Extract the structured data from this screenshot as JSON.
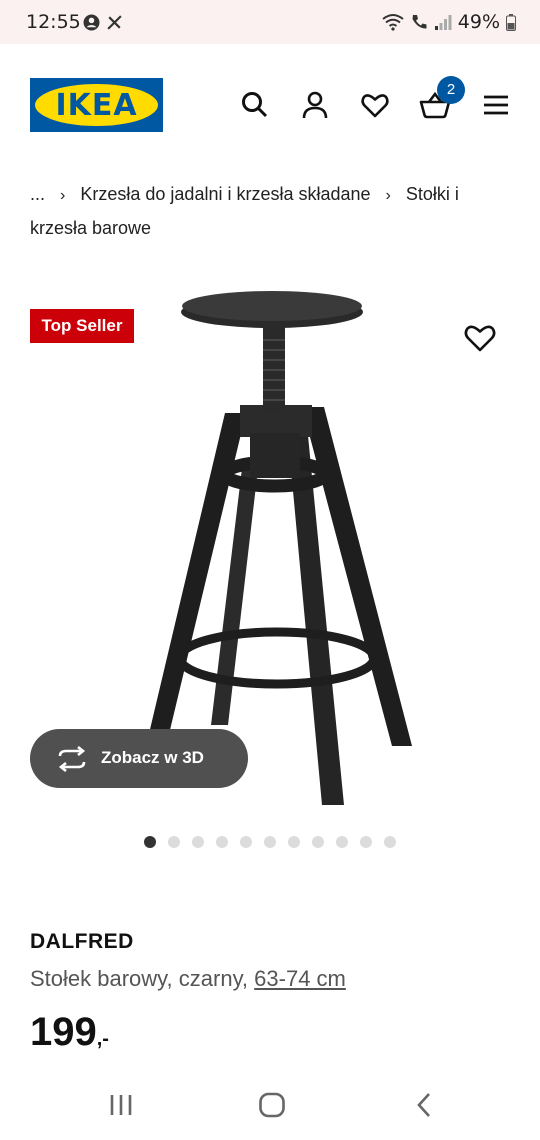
{
  "status_bar": {
    "time": "12:55",
    "battery": "49%"
  },
  "header": {
    "logo_text": "IKEA",
    "cart_count": "2",
    "icons": [
      "search-icon",
      "user-icon",
      "heart-icon",
      "cart-icon",
      "menu-icon"
    ]
  },
  "breadcrumb": {
    "ellipsis": "...",
    "items": [
      "Krzesła do jadalni i krzesła składane",
      "Stołki i krzesła barowe"
    ]
  },
  "product": {
    "badge": "Top Seller",
    "view_3d_label": "Zobacz w 3D",
    "image_count": 11,
    "active_image_index": 0,
    "name": "DALFRED",
    "description": "Stołek barowy, czarny,",
    "size_link": "63-74 cm",
    "price_main": "199",
    "price_suffix": ",-"
  },
  "colors": {
    "ikea_blue": "#0058a3",
    "ikea_yellow": "#ffdb00",
    "badge_red": "#cc0008",
    "button_grey": "#505050"
  }
}
